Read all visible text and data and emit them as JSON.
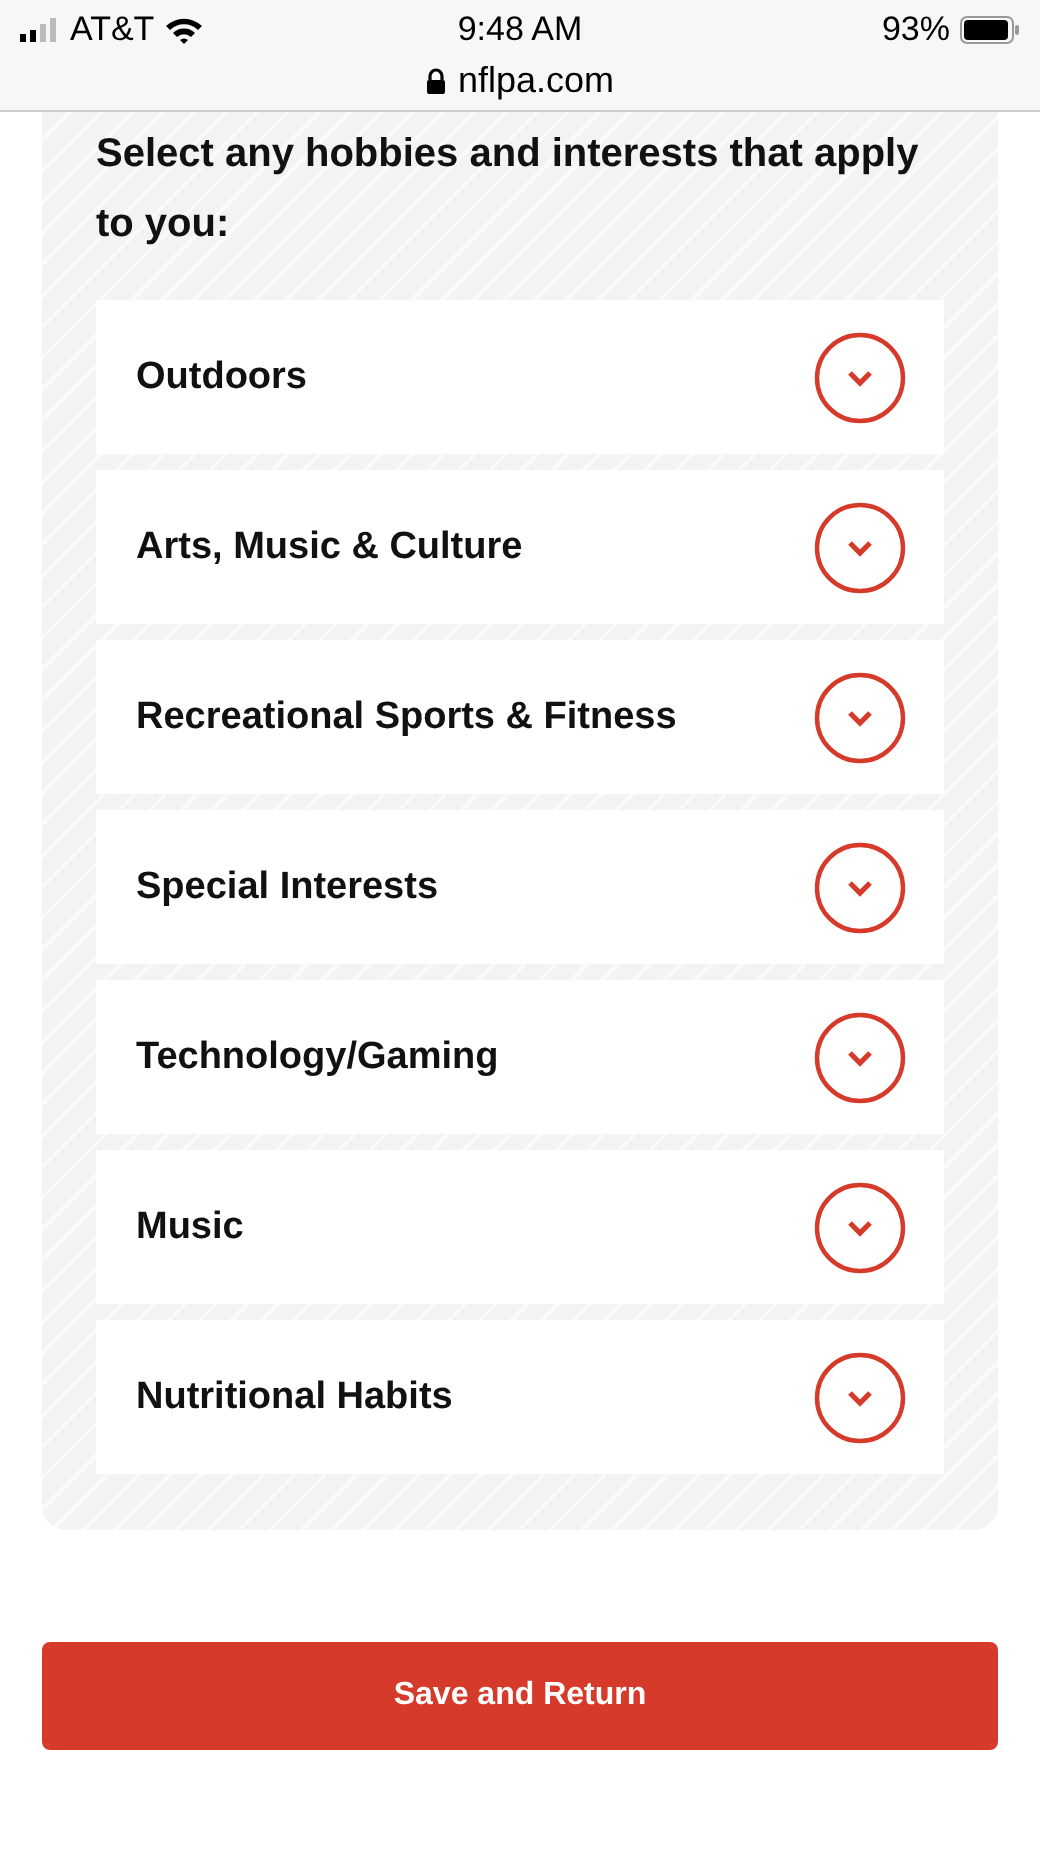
{
  "status_bar": {
    "carrier": "AT&T",
    "time": "9:48 AM",
    "battery": "93%",
    "url": "nflpa.com"
  },
  "heading": "Select any hobbies and interests that apply to you:",
  "categories": [
    {
      "label": "Outdoors",
      "expanded": false
    },
    {
      "label": "Arts, Music & Culture",
      "expanded": false
    },
    {
      "label": "Recreational Sports & Fitness",
      "expanded": false
    },
    {
      "label": "Special Interests",
      "expanded": false
    },
    {
      "label": "Technology/Gaming",
      "expanded": false
    },
    {
      "label": "Music",
      "expanded": false
    },
    {
      "label": "Nutritional Habits",
      "expanded": false
    }
  ],
  "save_button": "Save and Return"
}
